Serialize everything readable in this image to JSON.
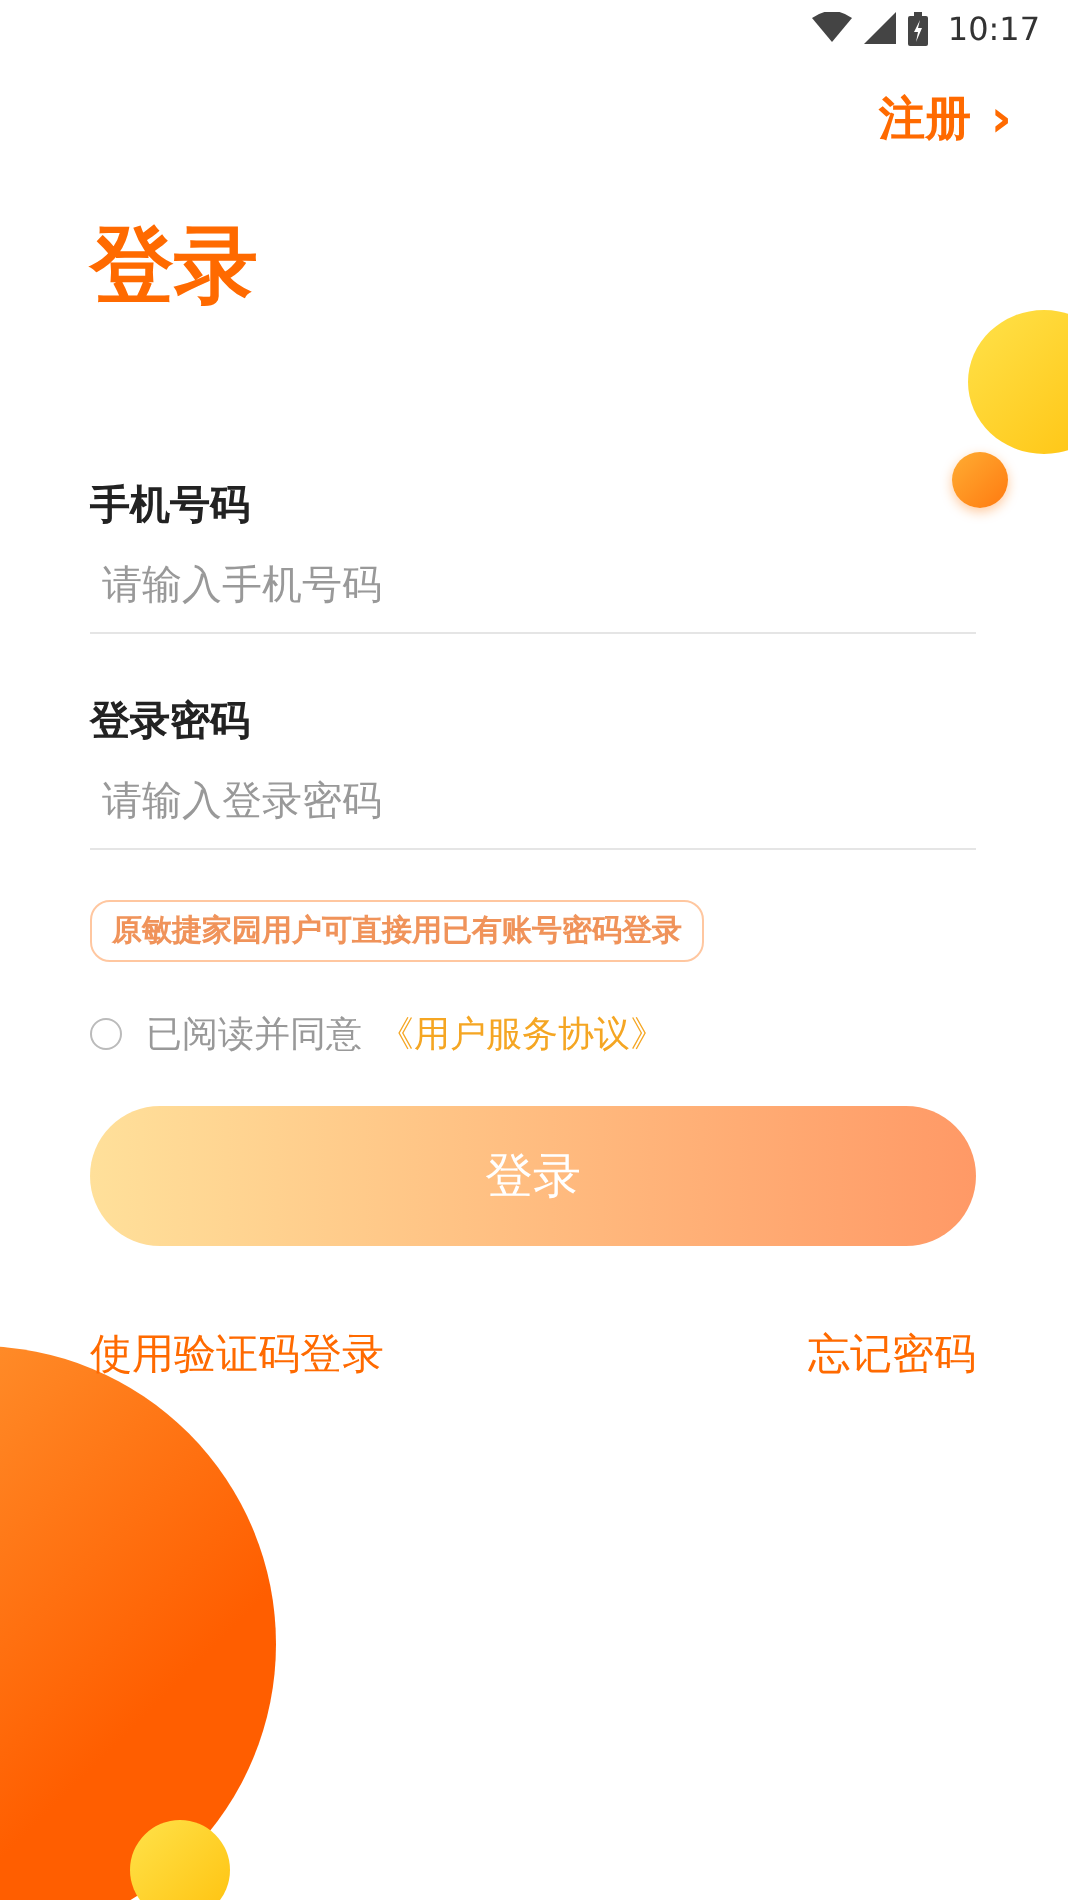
{
  "status_bar": {
    "time": "10:17"
  },
  "register_link": {
    "label": "注册",
    "arrow": "›"
  },
  "title": "登录",
  "fields": [
    {
      "label": "手机号码",
      "placeholder": "请输入手机号码"
    },
    {
      "label": "登录密码",
      "placeholder": "请输入登录密码"
    }
  ],
  "notice": "原敏捷家园用户可直接用已有账号密码登录",
  "agreement": {
    "checked": false,
    "text": "已阅读并同意",
    "link": "《用户服务协议》"
  },
  "login_button": "登录",
  "links": [
    "使用验证码登录",
    "忘记密码"
  ]
}
